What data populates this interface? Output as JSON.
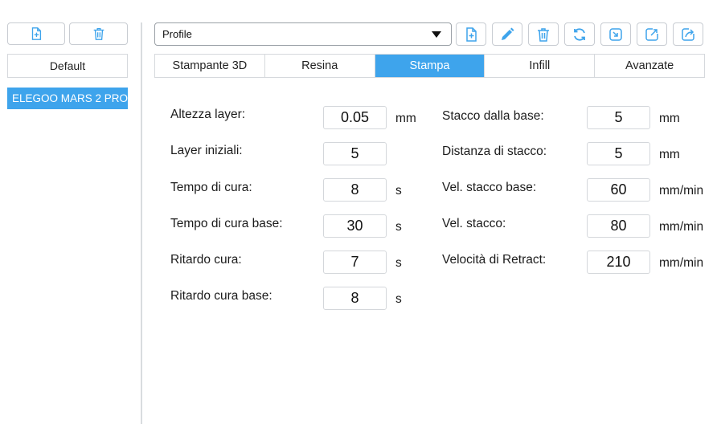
{
  "left_panel": {
    "default_label": "Default",
    "printers": [
      "ELEGOO MARS 2 PRO"
    ]
  },
  "toolbar": {
    "profile_value": "Profile"
  },
  "tabs": [
    {
      "label": "Stampante 3D",
      "active": false
    },
    {
      "label": "Resina",
      "active": false
    },
    {
      "label": "Stampa",
      "active": true
    },
    {
      "label": "Infill",
      "active": false
    },
    {
      "label": "Avanzate",
      "active": false
    }
  ],
  "accent_color": "#3ea4ec",
  "icon_color": "#3ea4ec",
  "form": {
    "left": [
      {
        "label": "Altezza layer:",
        "value": "0.05",
        "unit": "mm"
      },
      {
        "label": "Layer iniziali:",
        "value": "5",
        "unit": ""
      },
      {
        "label": "Tempo di cura:",
        "value": "8",
        "unit": "s"
      },
      {
        "label": "Tempo di cura base:",
        "value": "30",
        "unit": "s"
      },
      {
        "label": "Ritardo cura:",
        "value": "7",
        "unit": "s"
      },
      {
        "label": "Ritardo cura base:",
        "value": "8",
        "unit": "s"
      }
    ],
    "right": [
      {
        "label": "Stacco dalla base:",
        "value": "5",
        "unit": "mm"
      },
      {
        "label": "Distanza di stacco:",
        "value": "5",
        "unit": "mm"
      },
      {
        "label": "Vel. stacco base:",
        "value": "60",
        "unit": "mm/min"
      },
      {
        "label": "Vel. stacco:",
        "value": "80",
        "unit": "mm/min"
      },
      {
        "label": "Velocità di Retract:",
        "value": "210",
        "unit": "mm/min"
      }
    ]
  }
}
